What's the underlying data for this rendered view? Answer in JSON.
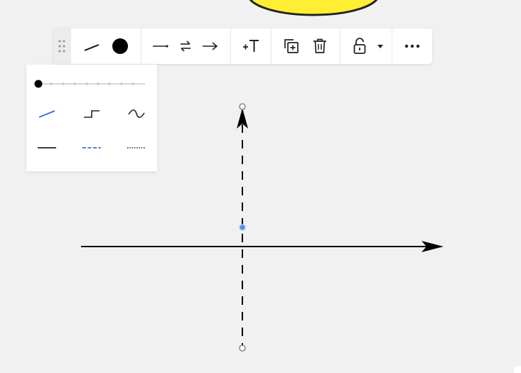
{
  "canvas": {
    "background": "#f1f1f1",
    "shape_fill": "#ffee33",
    "selection_color": "#4a90e2"
  },
  "toolbar": {
    "buttons": [
      "drag-handle-icon",
      "line-style-icon",
      "stroke-color-icon",
      "start-arrow-icon",
      "swap-direction-icon",
      "end-arrow-icon",
      "add-text-icon",
      "duplicate-icon",
      "delete-icon",
      "lock-icon",
      "caret-down-icon",
      "more-icon"
    ],
    "stroke_color": "#000000"
  },
  "line_style_panel": {
    "stroke_width_selected": 0,
    "stroke_width_steps": 9,
    "active_color": "#3b6fd4",
    "selected_shape": "straight",
    "selected_pattern": "dashed"
  }
}
